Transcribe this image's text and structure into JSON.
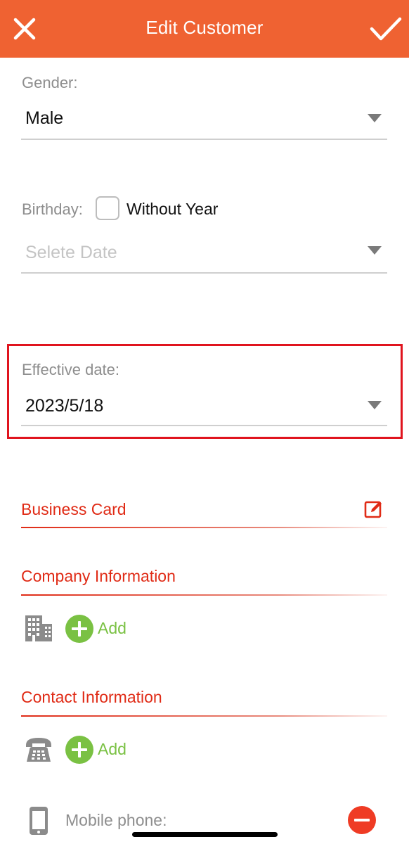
{
  "header": {
    "title": "Edit Customer",
    "close_icon": "close-icon",
    "save_icon": "checkmark-icon",
    "background_color": "#ef6232"
  },
  "gender": {
    "label": "Gender:",
    "value": "Male"
  },
  "birthday": {
    "label": "Birthday:",
    "without_year_label": "Without Year",
    "without_year_checked": false,
    "placeholder": "Selete Date"
  },
  "effective_date": {
    "label": "Effective date:",
    "value": "2023/5/18",
    "highlight_color": "#e0141e"
  },
  "sections": {
    "business_card": {
      "title": "Business Card",
      "icon": "edit-icon"
    },
    "company_information": {
      "title": "Company Information",
      "icon": "building-icon",
      "add_label": "Add"
    },
    "contact_information": {
      "title": "Contact Information",
      "icon": "telephone-icon",
      "add_label": "Add"
    }
  },
  "contact_entry": {
    "icon": "mobile-phone-icon",
    "label": "Mobile phone:",
    "remove_icon": "remove-icon"
  },
  "colors": {
    "accent_red": "#e02b16",
    "add_green": "#7ac143",
    "remove_red": "#ef3b24"
  }
}
